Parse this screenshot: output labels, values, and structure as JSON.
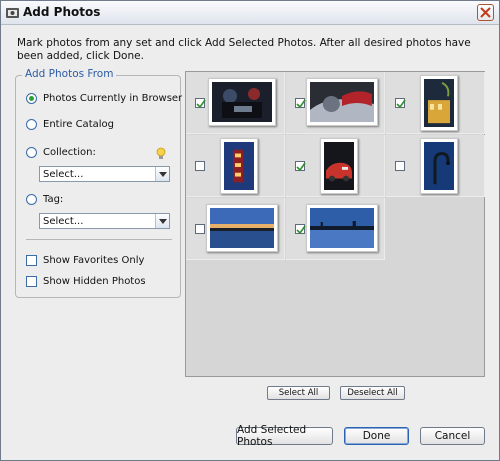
{
  "window": {
    "title": "Add Photos"
  },
  "instructions": "Mark photos from any set and click Add Selected Photos. After all desired photos have been added, click Done.",
  "add_from": {
    "legend": "Add Photos From",
    "options": [
      {
        "label": "Photos Currently in Browser",
        "selected": true
      },
      {
        "label": "Entire Catalog",
        "selected": false
      },
      {
        "label": "Collection:",
        "selected": false
      },
      {
        "label": "Tag:",
        "selected": false
      }
    ],
    "collection_select": "Select...",
    "tag_select": "Select...",
    "show_favorites_label": "Show Favorites Only",
    "show_hidden_label": "Show Hidden Photos"
  },
  "photos": [
    {
      "name": "motorcycle-rider",
      "checked": true
    },
    {
      "name": "motorcycle-detail",
      "checked": true
    },
    {
      "name": "building-lights",
      "checked": true
    },
    {
      "name": "neon-sign",
      "checked": false
    },
    {
      "name": "red-car",
      "checked": true
    },
    {
      "name": "blue-lamp",
      "checked": false
    },
    {
      "name": "sunset-lake",
      "checked": false
    },
    {
      "name": "dusk-shoreline",
      "checked": true
    }
  ],
  "buttons": {
    "select_all": "Select All",
    "deselect_all": "Deselect All",
    "add_selected": "Add Selected Photos",
    "done": "Done",
    "cancel": "Cancel"
  }
}
